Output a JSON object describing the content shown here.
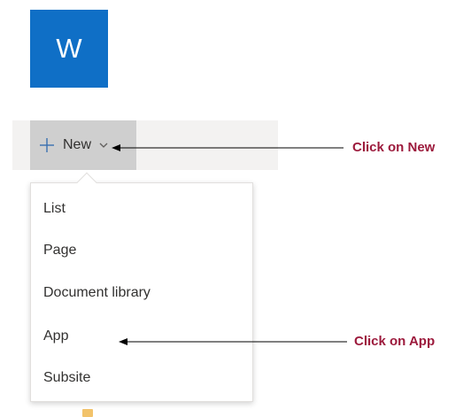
{
  "site": {
    "logo_letter": "W"
  },
  "command_bar": {
    "new_button": {
      "label": "New",
      "icon": "plus-icon",
      "menu_icon": "chevron-down-icon"
    }
  },
  "new_menu": {
    "items": [
      {
        "label": "List"
      },
      {
        "label": "Page"
      },
      {
        "label": "Document library"
      },
      {
        "label": "App"
      },
      {
        "label": "Subsite"
      }
    ]
  },
  "annotations": {
    "new_callout": "Click on New",
    "app_callout": "Click on App"
  },
  "colors": {
    "logo_bg": "#0f6fc6",
    "callout_text": "#9c1a3c",
    "new_button_bg": "#cfcfcf"
  }
}
